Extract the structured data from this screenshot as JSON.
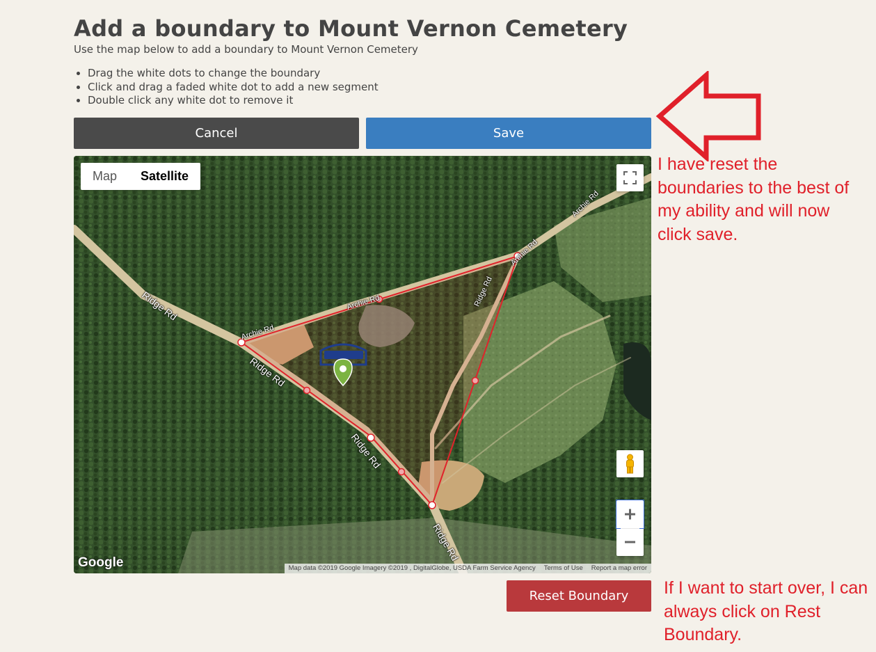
{
  "page": {
    "title": "Add a boundary to Mount Vernon Cemetery",
    "subtitle": "Use the map below to add a boundary to Mount Vernon Cemetery",
    "instructions": [
      "Drag the white dots to change the boundary",
      "Click and drag a faded white dot to add a new segment",
      "Double click any white dot to remove it"
    ]
  },
  "buttons": {
    "cancel": "Cancel",
    "save": "Save",
    "reset": "Reset Boundary"
  },
  "map": {
    "type_map": "Map",
    "type_satellite": "Satellite",
    "selected_type": "Satellite",
    "google_logo": "Google",
    "attribution": {
      "data": "Map data ©2019 Google Imagery ©2019 , DigitalGlobe, USDA Farm Service Agency",
      "terms": "Terms of Use",
      "report": "Report a map error"
    },
    "road_labels": {
      "ridge_upper": "Ridge Rd",
      "ridge_center": "Ridge Rd",
      "ridge_lower": "Ridge Rd",
      "ridge_bottom": "Ridge Rd",
      "ridge_right": "Ridge Rd",
      "archie_left": "Archie Rd",
      "archie_mid": "Archie Rd",
      "archie_corner": "Archie Rd",
      "archie_top": "Archie Rd"
    },
    "marker": "cemetery-marker-icon",
    "boundary_color": "#e0232b"
  },
  "annotations": {
    "top_note": "I have reset the boundaries to the best of my ability and will now click save.",
    "bottom_note": "If I want to start over, I can always click on Rest Boundary."
  },
  "colors": {
    "background": "#f4f1ea",
    "cancel": "#4a4a4a",
    "save": "#3a7ec0",
    "reset": "#b9393c",
    "annotation": "#e0202a"
  }
}
